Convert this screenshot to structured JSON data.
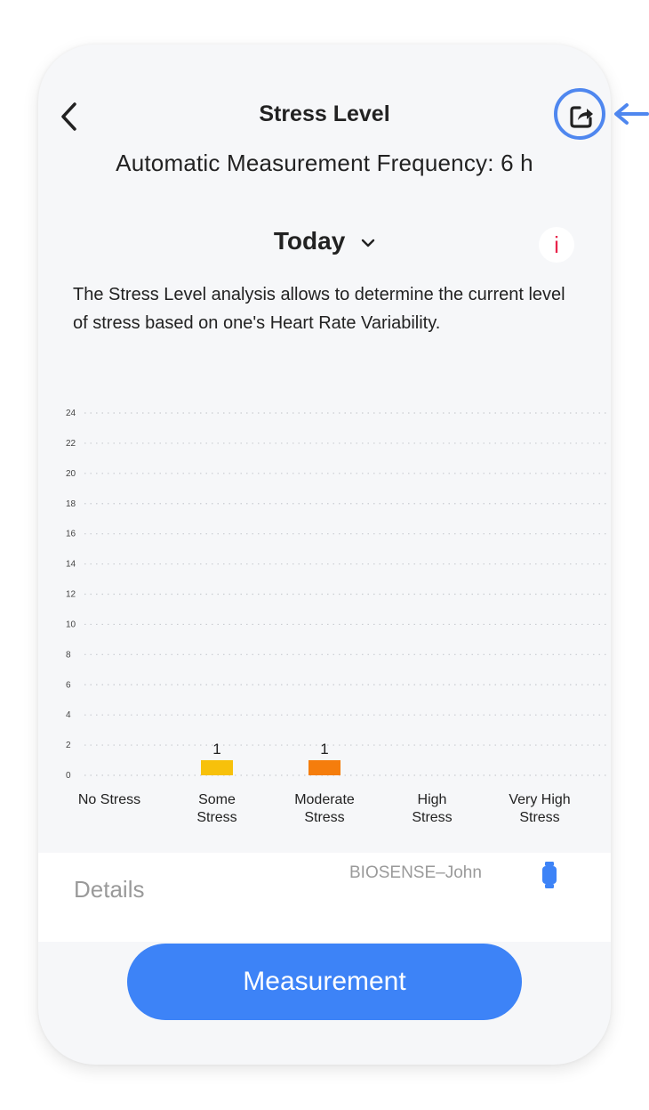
{
  "header": {
    "title": "Stress Level",
    "back_icon": "chevron-left-icon",
    "share_icon": "share-icon"
  },
  "subtitle": "Automatic Measurement Frequency: 6 h",
  "period": {
    "label": "Today",
    "icon": "chevron-down-icon"
  },
  "info": {
    "label": "i",
    "color": "#e8234a"
  },
  "description": "The Stress Level analysis allows to determine the current level of stress based on one's Heart Rate Variability.",
  "chart_data": {
    "type": "bar",
    "categories": [
      [
        "No Stress"
      ],
      [
        "Some",
        "Stress"
      ],
      [
        "Moderate",
        "Stress"
      ],
      [
        "High",
        "Stress"
      ],
      [
        "Very High",
        "Stress"
      ]
    ],
    "values": [
      0,
      1,
      1,
      0,
      0
    ],
    "data_labels": [
      "",
      "1",
      "1",
      "",
      ""
    ],
    "colors": [
      "#8fd14f",
      "#f7c10b",
      "#f57d0c",
      "#e8412f",
      "#b3122a"
    ],
    "yticks": [
      0,
      2,
      4,
      6,
      8,
      10,
      12,
      14,
      16,
      18,
      20,
      22,
      24
    ],
    "ylim": [
      0,
      24
    ],
    "grid": true,
    "title": "",
    "xlabel": "",
    "ylabel": ""
  },
  "details": {
    "label": "Details",
    "device_name": "BIOSENSE–John",
    "device_icon": "watch-icon",
    "device_icon_color": "#3d83f7"
  },
  "measurement_button": {
    "label": "Measurement",
    "color": "#3d83f7"
  },
  "annotation": {
    "highlight_color": "#4f87ef"
  }
}
